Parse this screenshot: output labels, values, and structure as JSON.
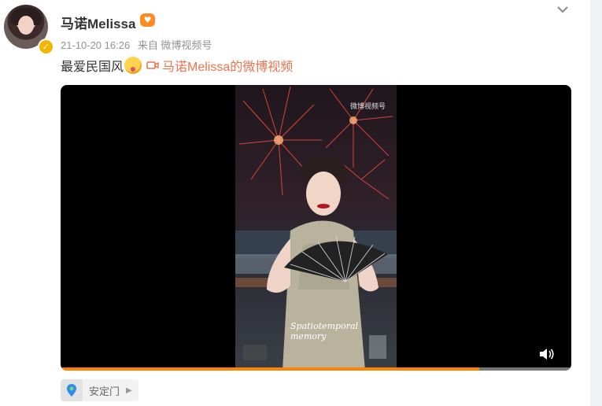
{
  "post": {
    "username": "马诺Melissa",
    "timestamp": "21-10-20 16:26",
    "source": "来自 微博视频号",
    "text": "最爱民国风",
    "video_link_text": "马诺Melissa的微博视频",
    "icons": {
      "verified": "verified-badge-icon",
      "vip": "vip-heart-icon",
      "expand": "chevron-down-icon",
      "emoji": "tongue-out-emoji-icon",
      "video": "video-camera-icon"
    }
  },
  "video": {
    "watermark": "微博视频号",
    "caption": "Spatiotemporal memory",
    "progress": 0.82,
    "volume_icon": "volume-icon"
  },
  "location": {
    "label": "安定门",
    "icon": "map-pin-icon",
    "arrow": "chevron-right-icon"
  },
  "colors": {
    "accent": "#eb7350",
    "progress": "#ff8200",
    "verified": "#f4b400"
  }
}
